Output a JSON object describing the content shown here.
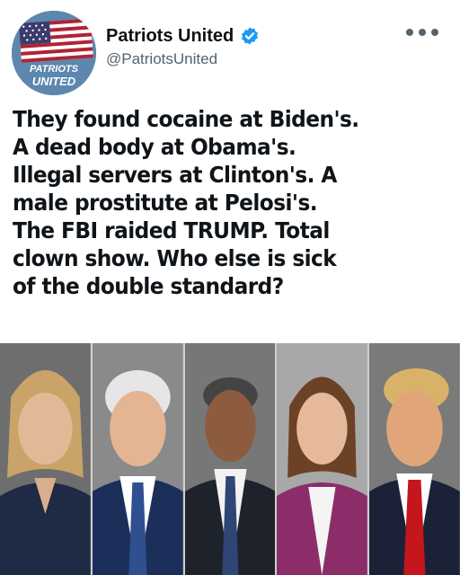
{
  "account": {
    "display_name": "Patriots United",
    "handle": "@PatriotsUnited",
    "avatar_text_line1": "PATRIOTS",
    "avatar_text_line2": "UNITED",
    "verified": true,
    "accent_color": "#1d9bf0"
  },
  "post": {
    "text": "They found cocaine at Biden's.\nA dead body at Obama's.\nIllegal servers at Clinton's. A\nmale prostitute at Pelosi's.\nThe FBI raided TRUMP. Total\nclown show. Who else is sick\nof the double standard?"
  },
  "menu": {
    "icon": "more-horizontal-icon"
  }
}
